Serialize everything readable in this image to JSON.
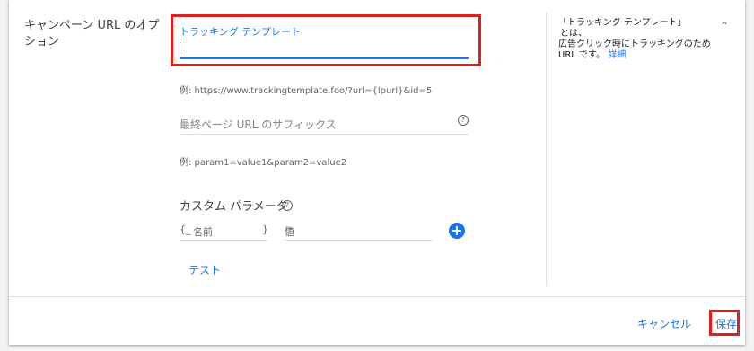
{
  "section": {
    "title": "キャンペーン URL のオプション"
  },
  "tracking_template": {
    "label": "トラッキング テンプレート",
    "value": "",
    "example": "例: https://www.trackingtemplate.foo/?url={lpurl}&id=5"
  },
  "final_url_suffix": {
    "placeholder": "最終ページ URL のサフィックス",
    "help_icon": "?",
    "example": "例: param1=value1&param2=value2"
  },
  "custom_parameters": {
    "title": "カスタム パラメータ",
    "help_icon": "?",
    "name_open": "{_",
    "name_placeholder": "名前",
    "name_close": "}",
    "equals": "=",
    "value_placeholder": "値",
    "add_icon": "+"
  },
  "test_link": "テスト",
  "side_help": {
    "line1": "「トラッキング テンプレート」",
    "line2": "とは、",
    "line3": "広告クリック時にトラッキングのため",
    "line4": "URL です。",
    "link": "詳細"
  },
  "collapse_icon": "⌃",
  "footer": {
    "cancel": "キャンセル",
    "save": "保存"
  },
  "colors": {
    "accent": "#1a73e8",
    "highlight": "#e02020"
  }
}
